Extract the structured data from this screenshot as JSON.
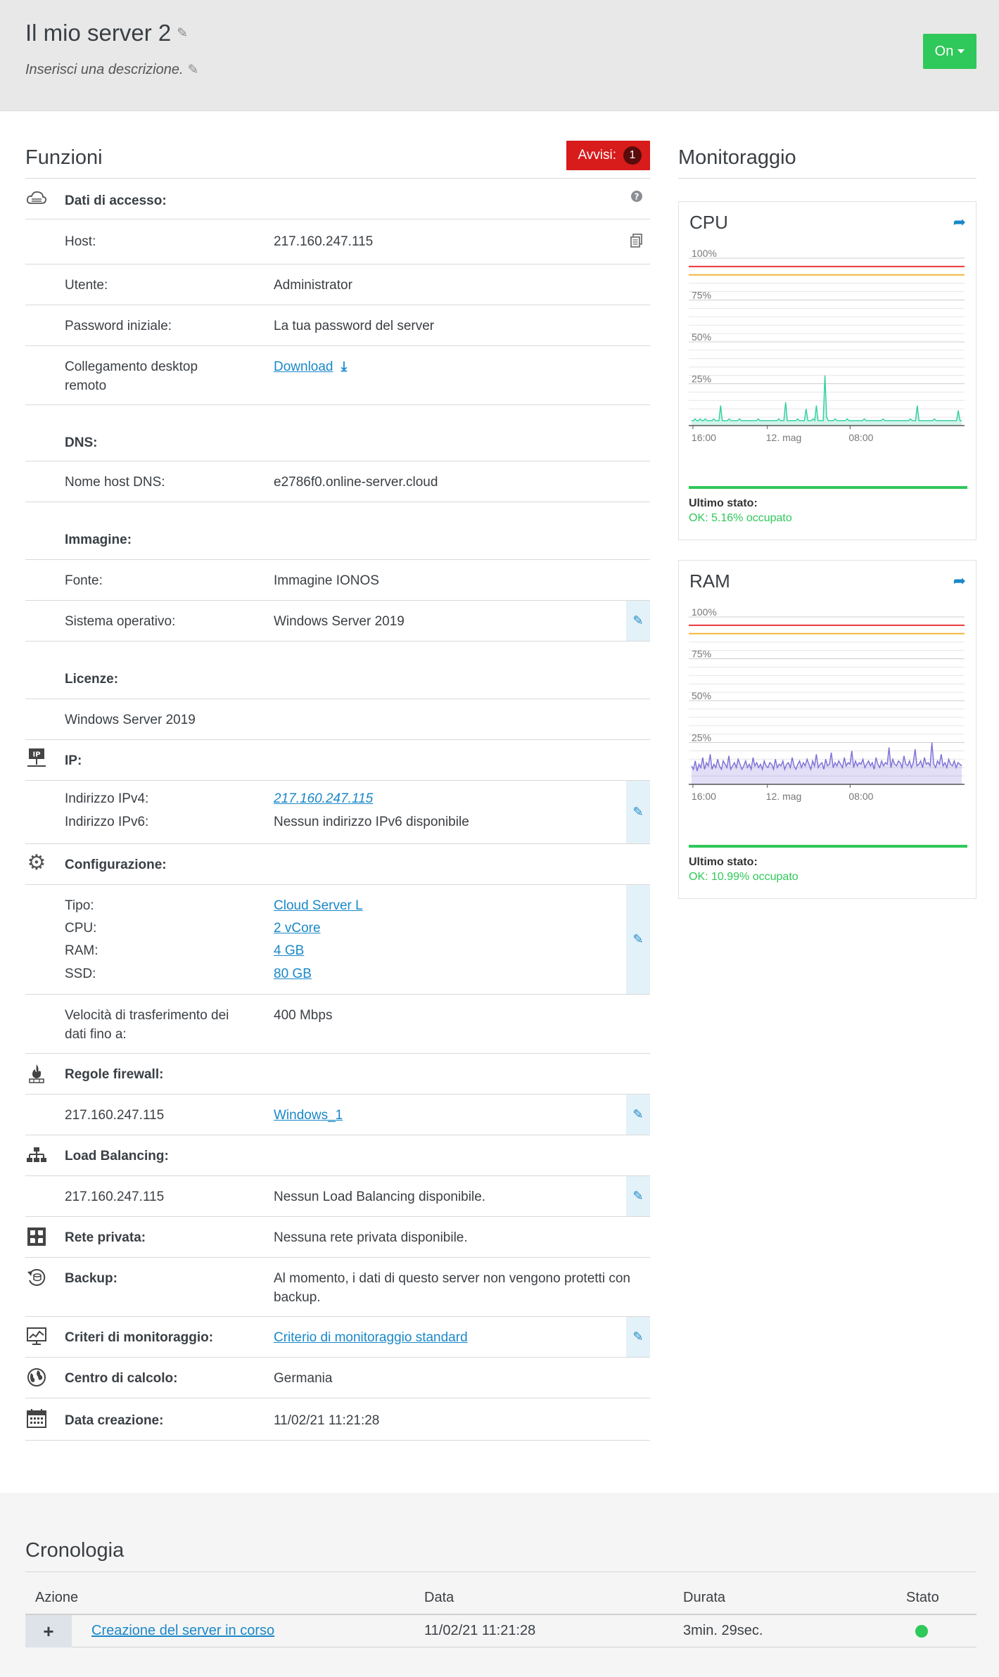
{
  "header": {
    "server_name": "Il mio server 2",
    "description_placeholder": "Inserisci una descrizione.",
    "power_button": "On"
  },
  "functions": {
    "title": "Funzioni",
    "alerts_label": "Avvisi:",
    "alerts_count": "1",
    "access": {
      "heading": "Dati di accesso:",
      "host_label": "Host:",
      "host_value": "217.160.247.115",
      "user_label": "Utente:",
      "user_value": "Administrator",
      "password_label": "Password iniziale:",
      "password_value": "La tua password del server",
      "rdp_label": "Collegamento desktop remoto",
      "rdp_value": "Download"
    },
    "dns": {
      "heading": "DNS:",
      "hostname_label": "Nome host DNS:",
      "hostname_value": "e2786f0.online-server.cloud"
    },
    "image": {
      "heading": "Immagine:",
      "source_label": "Fonte:",
      "source_value": "Immagine IONOS",
      "os_label": "Sistema operativo:",
      "os_value": "Windows Server 2019"
    },
    "licenses": {
      "heading": "Licenze:",
      "value": "Windows Server 2019"
    },
    "ip": {
      "heading": "IP:",
      "icon_text": "IP",
      "ipv4_label": "Indirizzo IPv4:",
      "ipv4_value": "217.160.247.115",
      "ipv6_label": "Indirizzo IPv6:",
      "ipv6_value": "Nessun indirizzo IPv6 disponibile"
    },
    "config": {
      "heading": "Configurazione:",
      "type_label": "Tipo:",
      "type_value": "Cloud Server L",
      "cpu_label": "CPU:",
      "cpu_value": "2 vCore",
      "ram_label": "RAM:",
      "ram_value": "4 GB",
      "ssd_label": "SSD:",
      "ssd_value": "80 GB",
      "speed_label": "Velocità di trasferimento dei dati fino a:",
      "speed_value": "400 Mbps"
    },
    "firewall": {
      "heading": "Regole firewall:",
      "ip": "217.160.247.115",
      "rule": "Windows_1"
    },
    "lb": {
      "heading": "Load Balancing:",
      "ip": "217.160.247.115",
      "value": "Nessun Load Balancing disponibile."
    },
    "private_net": {
      "label": "Rete privata:",
      "value": "Nessuna rete privata disponibile."
    },
    "backup": {
      "label": "Backup:",
      "value": "Al momento, i dati di questo server non vengono protetti con backup."
    },
    "monitoring_policy": {
      "label": "Criteri di monitoraggio:",
      "value": "Criterio di monitoraggio standard"
    },
    "datacenter": {
      "label": "Centro di calcolo:",
      "value": "Germania"
    },
    "created": {
      "label": "Data creazione:",
      "value": "11/02/21 11:21:28"
    }
  },
  "monitoring": {
    "title": "Monitoraggio",
    "last_status_label": "Ultimo stato:",
    "cpu_title": "CPU",
    "cpu_status": "OK: 5.16% occupato",
    "ram_title": "RAM",
    "ram_status": "OK: 10.99% occupato",
    "y_ticks": [
      "100%",
      "75%",
      "50%",
      "25%"
    ],
    "x_ticks": [
      "16:00",
      "12. mag",
      "08:00"
    ]
  },
  "chart_data": [
    {
      "type": "area",
      "title": "CPU",
      "ylim": [
        0,
        100
      ],
      "x_ticks": [
        "16:00",
        "12. mag",
        "08:00"
      ],
      "thresholds": [
        {
          "value": 95,
          "color": "#e8373c"
        },
        {
          "value": 90,
          "color": "#f3b53a"
        }
      ],
      "series": [
        {
          "color": "#2fcfa0",
          "values": [
            3,
            3,
            4,
            3,
            3,
            4,
            3,
            3,
            4,
            3,
            3,
            3,
            3,
            4,
            3,
            3,
            3,
            12,
            3,
            3,
            3,
            3,
            4,
            3,
            3,
            3,
            3,
            3,
            4,
            3,
            3,
            3,
            3,
            3,
            3,
            3,
            3,
            3,
            3,
            4,
            3,
            3,
            3,
            3,
            3,
            3,
            3,
            3,
            3,
            3,
            3,
            4,
            3,
            3,
            3,
            14,
            3,
            3,
            3,
            3,
            3,
            3,
            4,
            3,
            3,
            3,
            3,
            10,
            3,
            3,
            3,
            4,
            3,
            12,
            3,
            3,
            3,
            3,
            30,
            5,
            3,
            3,
            3,
            3,
            4,
            3,
            3,
            3,
            3,
            3,
            3,
            4,
            3,
            3,
            3,
            3,
            3,
            3,
            3,
            3,
            3,
            4,
            3,
            3,
            3,
            3,
            3,
            3,
            3,
            3,
            3,
            3,
            4,
            3,
            3,
            3,
            3,
            3,
            3,
            3,
            3,
            3,
            3,
            3,
            3,
            3,
            3,
            3,
            4,
            3,
            3,
            3,
            12,
            3,
            3,
            3,
            3,
            3,
            3,
            3,
            3,
            3,
            4,
            3,
            3,
            3,
            3,
            3,
            3,
            3,
            3,
            3,
            3,
            3,
            3,
            3,
            9,
            3,
            3
          ]
        }
      ]
    },
    {
      "type": "area",
      "title": "RAM",
      "ylim": [
        0,
        100
      ],
      "x_ticks": [
        "16:00",
        "12. mag",
        "08:00"
      ],
      "thresholds": [
        {
          "value": 95,
          "color": "#e8373c"
        },
        {
          "value": 90,
          "color": "#f3b53a"
        }
      ],
      "series": [
        {
          "color": "#7b6fd6",
          "values": [
            11,
            9,
            14,
            8,
            12,
            10,
            16,
            9,
            13,
            11,
            18,
            9,
            12,
            10,
            15,
            11,
            9,
            14,
            12,
            10,
            17,
            9,
            11,
            13,
            10,
            15,
            12,
            9,
            11,
            14,
            10,
            12,
            9,
            16,
            11,
            13,
            10,
            12,
            9,
            14,
            11,
            10,
            13,
            12,
            9,
            15,
            10,
            12,
            11,
            14,
            9,
            12,
            13,
            10,
            16,
            11,
            9,
            12,
            14,
            10,
            13,
            11,
            15,
            12,
            9,
            14,
            11,
            18,
            10,
            12,
            13,
            9,
            15,
            11,
            12,
            19,
            10,
            13,
            11,
            14,
            12,
            10,
            16,
            11,
            13,
            12,
            20,
            10,
            14,
            11,
            13,
            12,
            15,
            10,
            12,
            14,
            11,
            13,
            9,
            16,
            12,
            10,
            14,
            11,
            13,
            12,
            22,
            10,
            15,
            12,
            11,
            14,
            13,
            10,
            17,
            12,
            11,
            14,
            10,
            13,
            21,
            11,
            12,
            14,
            10,
            16,
            12,
            13,
            11,
            25,
            12,
            10,
            14,
            12,
            18,
            11,
            13,
            10,
            15,
            12,
            11,
            14,
            10,
            13,
            12,
            11
          ]
        }
      ]
    }
  ],
  "history": {
    "title": "Cronologia",
    "columns": [
      "Azione",
      "Data",
      "Durata",
      "Stato"
    ],
    "row": {
      "action": "Creazione del server in corso",
      "date": "11/02/21 11:21:28",
      "duration": "3min. 29sec."
    }
  }
}
